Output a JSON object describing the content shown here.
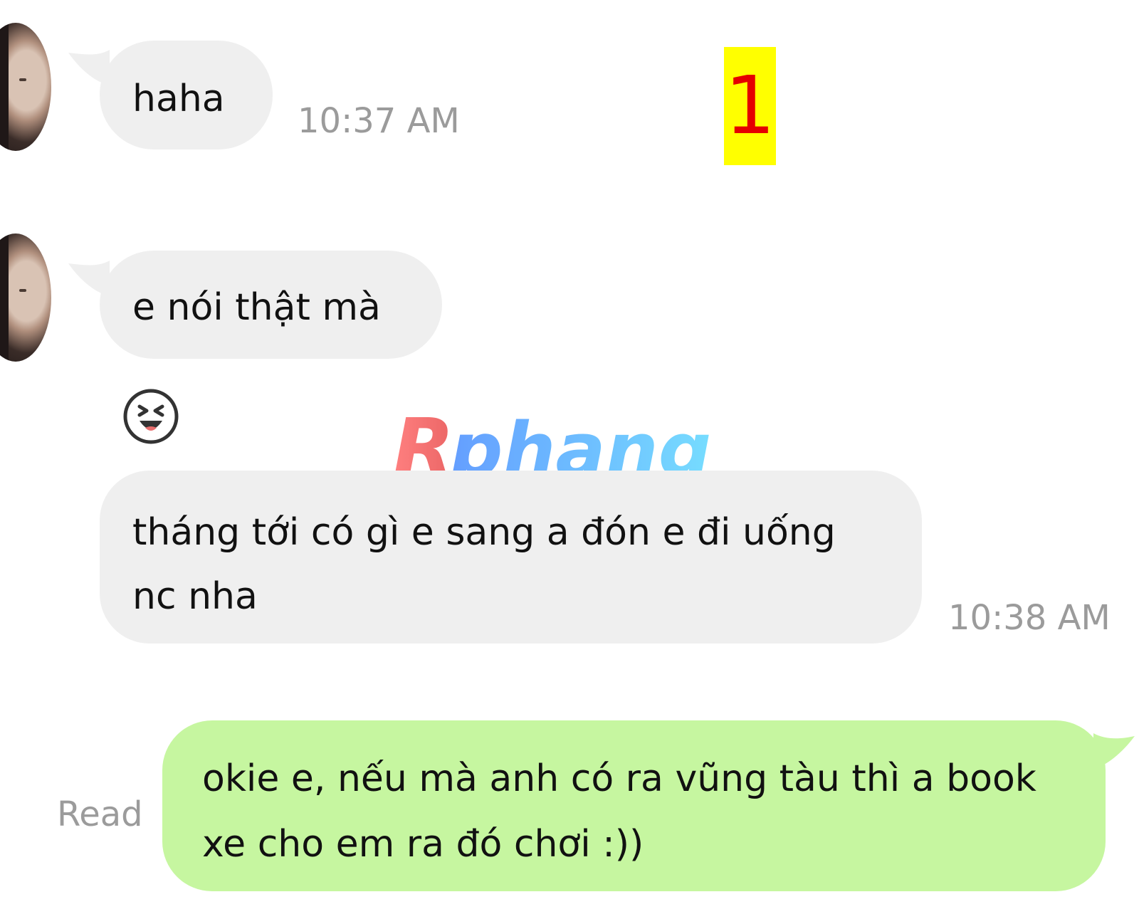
{
  "messages": [
    {
      "text": "haha",
      "time": "10:37 AM"
    },
    {
      "text": "e nói thật mà"
    },
    {
      "text": "tháng tới có gì e sang a đón e đi uống nc nha",
      "time": "10:38 AM"
    },
    {
      "text": "okie e, nếu mà anh có ra vũng tàu thì a book xe cho em ra đó chơi :))",
      "status": "Read"
    }
  ],
  "overlay": {
    "number_label": "1",
    "watermark": "Rphang"
  },
  "colors": {
    "incoming_bubble": "#efefef",
    "outgoing_bubble": "#c6f6a0",
    "timestamp": "#9b9b9b",
    "badge_bg": "#ffff00",
    "badge_text": "#e50000"
  },
  "icons": {
    "reaction": "laughing-face-icon"
  }
}
